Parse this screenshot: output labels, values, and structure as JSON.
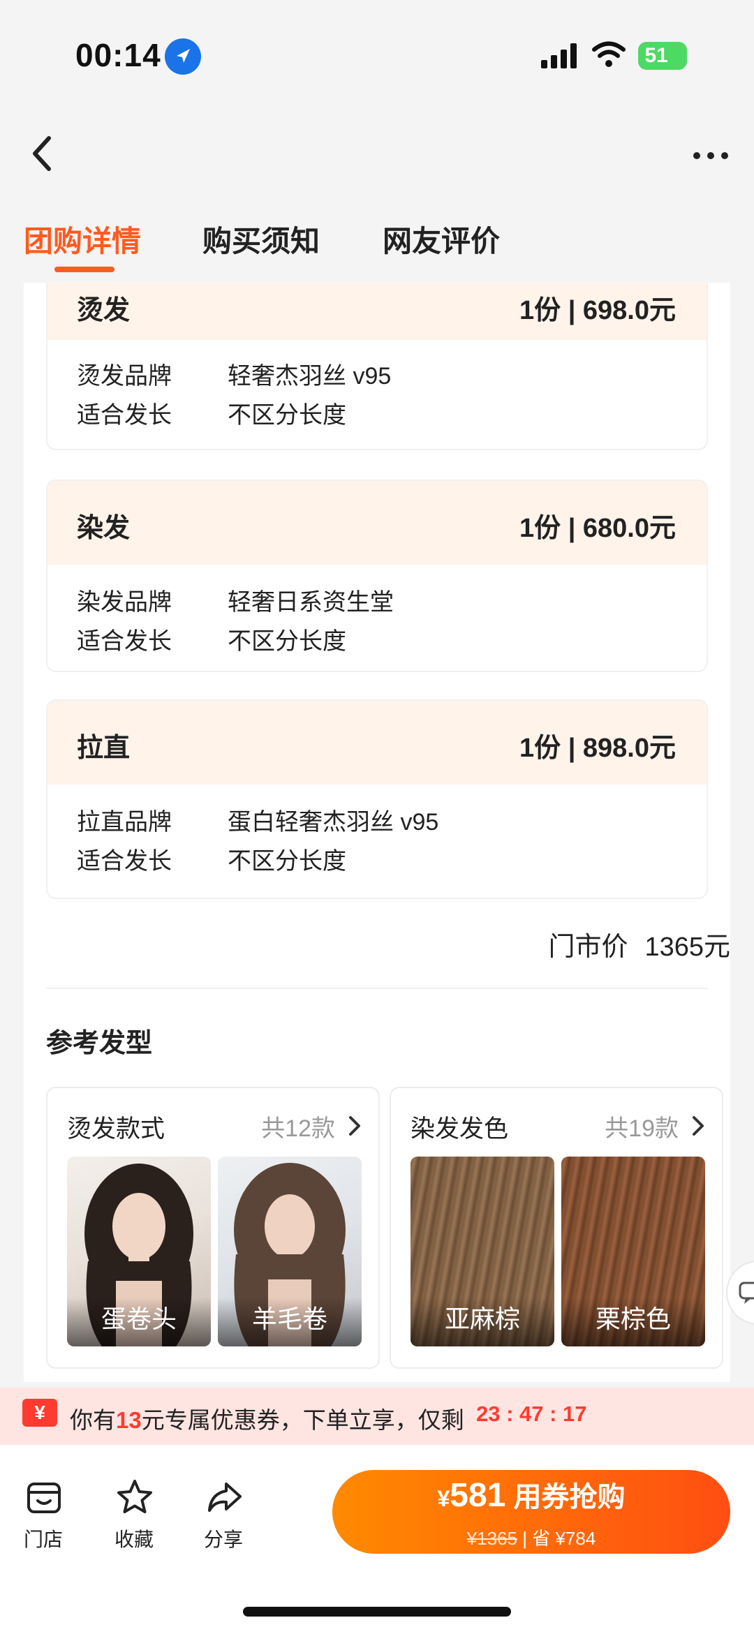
{
  "status_bar": {
    "time": "00:14",
    "battery": "51"
  },
  "tabs": [
    {
      "label": "团购详情",
      "active": true
    },
    {
      "label": "购买须知",
      "active": false
    },
    {
      "label": "网友评价",
      "active": false
    }
  ],
  "services": [
    {
      "name": "烫发",
      "price": "1份 | 698.0元",
      "rows": [
        {
          "label": "烫发品牌",
          "value": "轻奢杰羽丝 v95"
        },
        {
          "label": "适合发长",
          "value": "不区分长度"
        }
      ]
    },
    {
      "name": "染发",
      "price": "1份 | 680.0元",
      "rows": [
        {
          "label": "染发品牌",
          "value": "轻奢日系资生堂"
        },
        {
          "label": "适合发长",
          "value": "不区分长度"
        }
      ]
    },
    {
      "name": "拉直",
      "price": "1份 | 898.0元",
      "rows": [
        {
          "label": "拉直品牌",
          "value": "蛋白轻奢杰羽丝 v95"
        },
        {
          "label": "适合发长",
          "value": "不区分长度"
        }
      ]
    }
  ],
  "market_price": {
    "label": "门市价",
    "value": "1365元"
  },
  "reference": {
    "title": "参考发型",
    "cards": [
      {
        "title": "烫发款式",
        "count": "共12款",
        "thumbs": [
          "蛋卷头",
          "羊毛卷"
        ]
      },
      {
        "title": "染发发色",
        "count": "共19款",
        "thumbs": [
          "亚麻棕",
          "栗棕色"
        ]
      }
    ]
  },
  "coupon": {
    "icon": "¥",
    "prefix": "你有",
    "amount": "13",
    "suffix": "元专属优惠券，下单立享，仅剩",
    "timer": "23 : 47 : 17"
  },
  "bottom_bar": {
    "items": [
      {
        "label": "门店",
        "icon": "store-icon"
      },
      {
        "label": "收藏",
        "icon": "star-icon"
      },
      {
        "label": "分享",
        "icon": "share-icon"
      }
    ],
    "buy": {
      "currency": "¥",
      "price": "581",
      "label": "用券抢购",
      "original": "¥1365",
      "save": "省 ¥784"
    }
  },
  "colors": {
    "accent": "#ff5a1f",
    "header_bg": "#fff3ea",
    "coupon_bg": "#ffe5e2",
    "coupon_red": "#ff3b30"
  }
}
